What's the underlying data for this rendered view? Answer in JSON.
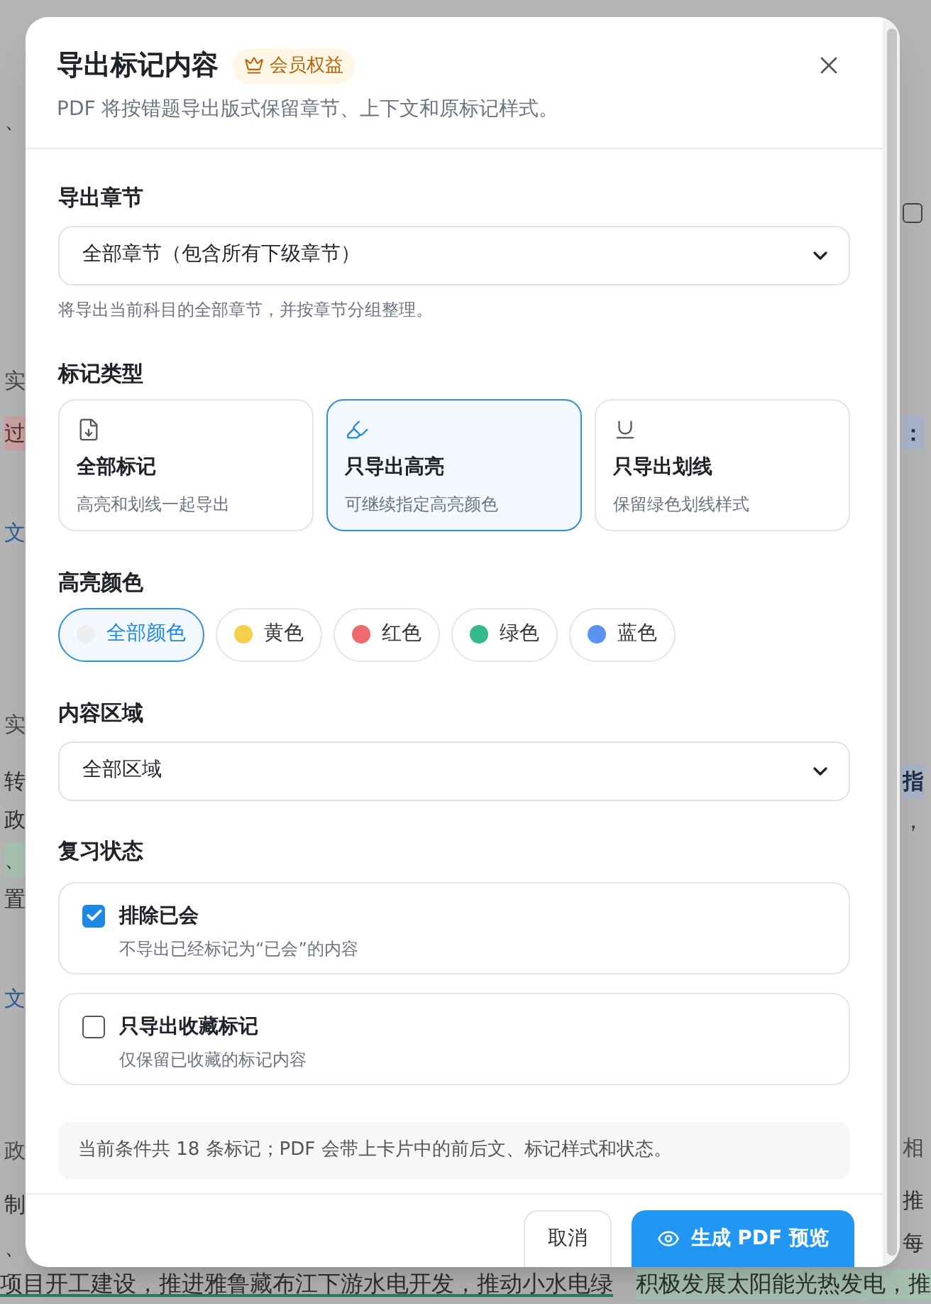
{
  "backdrop": {
    "left_fragments": [
      {
        "text": "、",
        "kind": "plain"
      },
      {
        "text": "实",
        "kind": "muted"
      },
      {
        "text": "过",
        "kind": "red"
      },
      {
        "text": "文",
        "kind": "link"
      },
      {
        "text": "实",
        "kind": "muted"
      },
      {
        "text": "转",
        "kind": "plain"
      },
      {
        "text": "政",
        "kind": "plain"
      },
      {
        "text": "、",
        "kind": "green"
      },
      {
        "text": "置",
        "kind": "plain"
      },
      {
        "text": "文",
        "kind": "link"
      },
      {
        "text": "政",
        "kind": "muted"
      },
      {
        "text": "制",
        "kind": "plain"
      },
      {
        "text": "、",
        "kind": "plain"
      }
    ],
    "right_fragments": [
      {
        "kind": "checkbox",
        "checked": false
      },
      {
        "text": "：",
        "kind": "blue"
      },
      {
        "text": "指",
        "kind": "blue"
      },
      {
        "text": "，",
        "kind": "plain"
      },
      {
        "text": "相",
        "kind": "muted"
      },
      {
        "text": "推",
        "kind": "plain"
      },
      {
        "text": "每",
        "kind": "plain"
      }
    ],
    "bottom_row": [
      {
        "text": "项目开工建设，推进雅鲁藏布江下游水电开发，推动小水电绿",
        "kind": "underline"
      },
      {
        "text": "积极发展太阳能光热发电，推",
        "kind": "green"
      }
    ]
  },
  "dialog": {
    "title": "导出标记内容",
    "badge": "会员权益",
    "subtitle": "PDF 将按错题导出版式保留章节、上下文和原标记样式。",
    "chapter": {
      "label": "导出章节",
      "value": "全部章节（包含所有下级章节）",
      "hint": "将导出当前科目的全部章节，并按章节分组整理。"
    },
    "mark_type": {
      "label": "标记类型",
      "options": [
        {
          "kind": "all",
          "title": "全部标记",
          "description": "高亮和划线一起导出",
          "selected": false
        },
        {
          "kind": "highlight",
          "title": "只导出高亮",
          "description": "可继续指定高亮颜色",
          "selected": true
        },
        {
          "kind": "underline",
          "title": "只导出划线",
          "description": "保留绿色划线样式",
          "selected": false
        }
      ]
    },
    "highlight_color": {
      "label": "高亮颜色",
      "options": [
        {
          "label": "全部颜色",
          "color": "#eceef0",
          "selected": true
        },
        {
          "label": "黄色",
          "color": "#f6cf4a",
          "selected": false
        },
        {
          "label": "红色",
          "color": "#ee6b6b",
          "selected": false
        },
        {
          "label": "绿色",
          "color": "#34b98a",
          "selected": false
        },
        {
          "label": "蓝色",
          "color": "#5b93f3",
          "selected": false
        }
      ]
    },
    "content_area": {
      "label": "内容区域",
      "value": "全部区域"
    },
    "review_status": {
      "label": "复习状态",
      "options": [
        {
          "title": "排除已会",
          "description": "不导出已经标记为“已会”的内容",
          "checked": true
        },
        {
          "title": "只导出收藏标记",
          "description": "仅保留已收藏的标记内容",
          "checked": false
        }
      ]
    },
    "summary": "当前条件共 18 条标记；PDF 会带上卡片中的前后文、标记样式和状态。",
    "buttons": {
      "cancel": "取消",
      "primary": "生成 PDF 预览"
    }
  }
}
